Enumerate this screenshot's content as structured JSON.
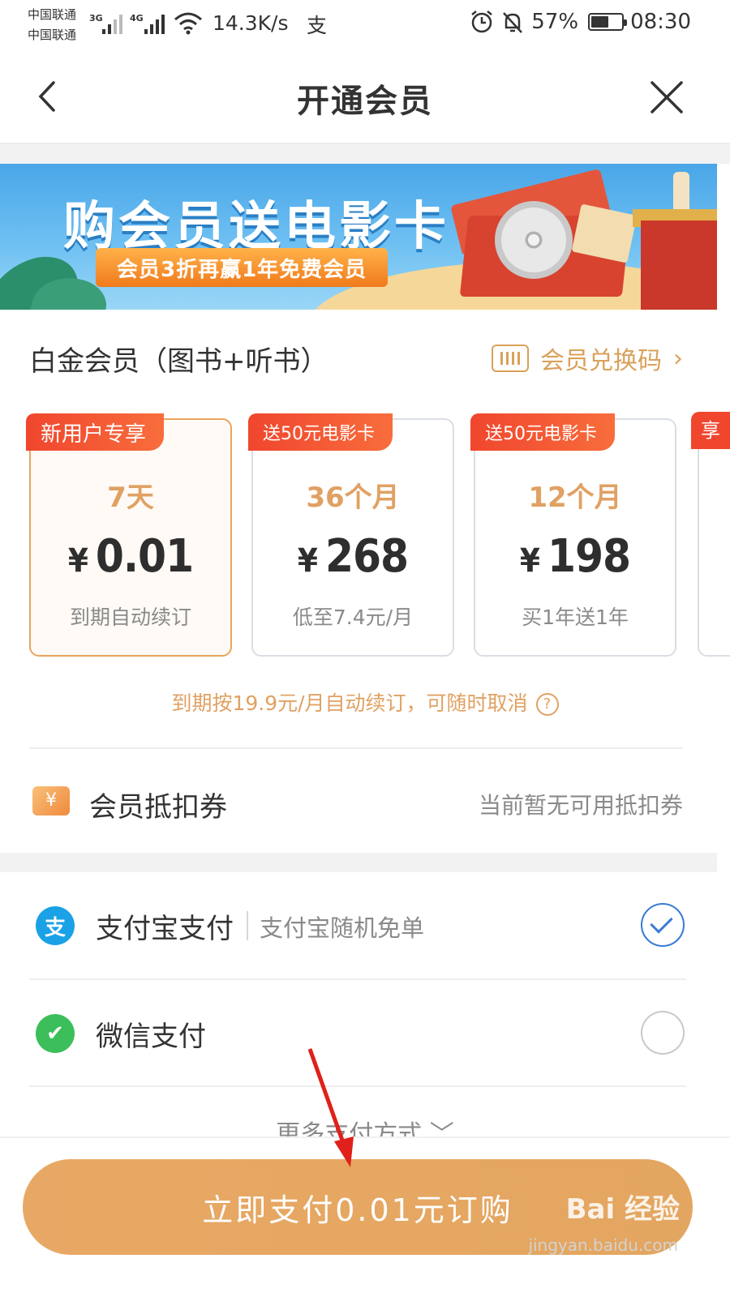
{
  "status_bar": {
    "carrier_1": "中国联通",
    "carrier_2": "中国联通",
    "net_1": "3G",
    "net_2": "4G",
    "speed": "14.3K/s",
    "battery": "57%",
    "battery_level": 0.57,
    "time": "08:30"
  },
  "nav": {
    "title": "开通会员"
  },
  "banner": {
    "headline": "购会员送电影卡",
    "ribbon": "会员3折再赢1年免费会员"
  },
  "membership": {
    "title": "白金会员（图书+听书）",
    "redeem_label": "会员兑换码",
    "plans": [
      {
        "tag": "新用户专享",
        "duration": "7天",
        "currency": "¥",
        "price": "0.01",
        "sub": "到期自动续订",
        "selected": true
      },
      {
        "tag": "送50元电影卡",
        "duration": "36个月",
        "currency": "¥",
        "price": "268",
        "sub": "低至7.4元/月",
        "selected": false
      },
      {
        "tag": "送50元电影卡",
        "duration": "12个月",
        "currency": "¥",
        "price": "198",
        "sub": "买1年送1年",
        "selected": false
      }
    ],
    "peek_tag": "享",
    "renew_note": "到期按19.9元/月自动续订，可随时取消",
    "help_icon": "?"
  },
  "coupon": {
    "icon": "¥",
    "label": "会员抵扣券",
    "value": "当前暂无可用抵扣券"
  },
  "payment": {
    "methods": [
      {
        "icon": "支",
        "label": "支付宝支付",
        "sub": "支付宝随机免单",
        "checked": true
      },
      {
        "icon": "✔",
        "label": "微信支付",
        "sub": "",
        "checked": false
      }
    ],
    "more": "更多支付方式 ﹀"
  },
  "footer": {
    "pay_button": "立即支付0.01元订购"
  },
  "watermark": {
    "brand": "Bai 经验",
    "url": "jingyan.baidu.com"
  },
  "colors": {
    "accent": "#e0a163",
    "tag_red": "#f0462e",
    "button": "#e6a763",
    "check_blue": "#3a7bd5"
  }
}
